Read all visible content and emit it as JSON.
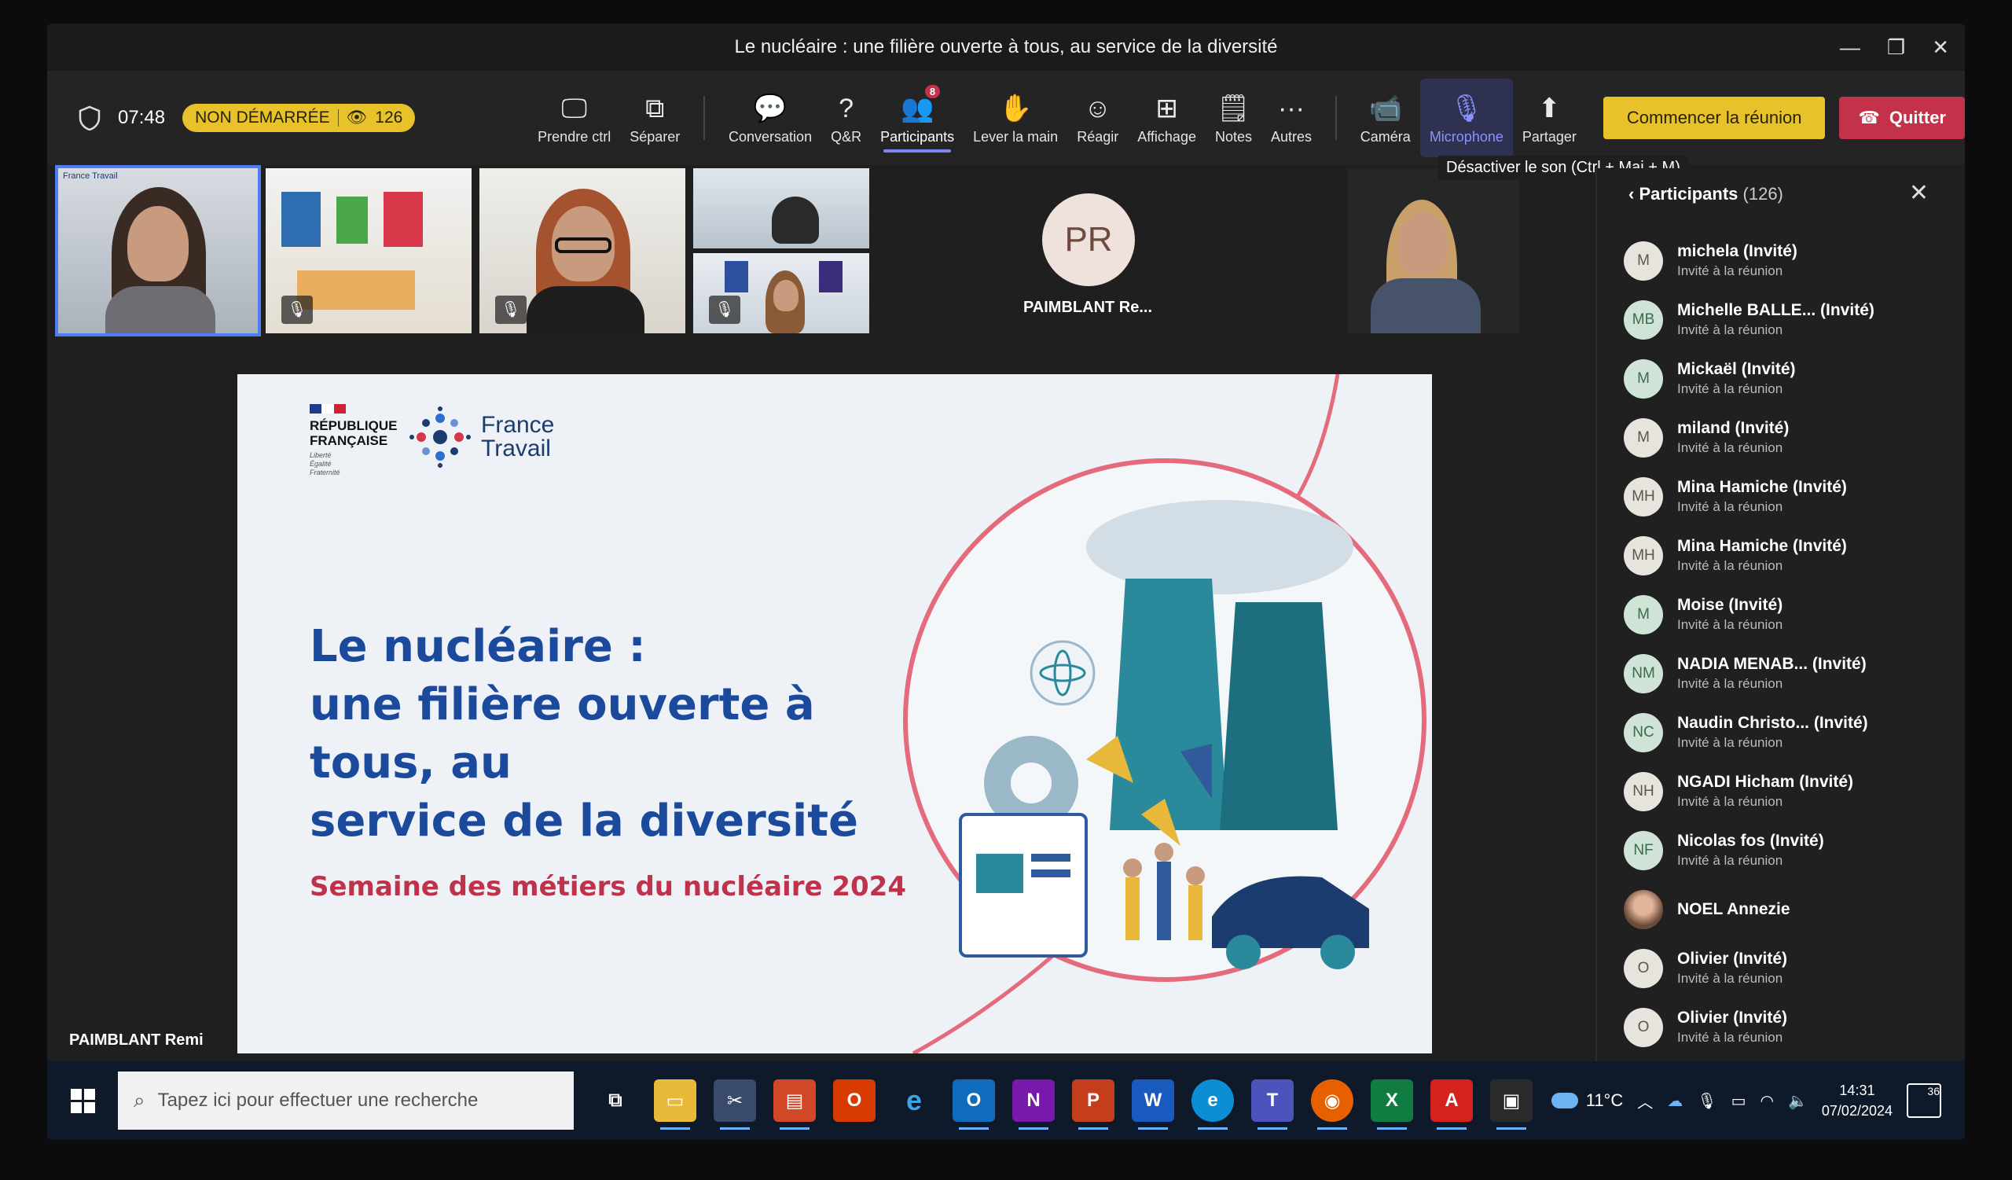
{
  "window": {
    "title": "Le nucléaire : une filière ouverte à tous, au service de la diversité"
  },
  "toolbar": {
    "time": "07:48",
    "status": "NON DÉMARRÉE",
    "viewers": "126",
    "buttons": [
      {
        "label": "Prendre ctrl",
        "icon": "take-control-icon"
      },
      {
        "label": "Séparer",
        "icon": "pop-out-icon"
      },
      {
        "label": "Conversation",
        "icon": "chat-icon"
      },
      {
        "label": "Q&R",
        "icon": "qa-icon"
      },
      {
        "label": "Participants",
        "icon": "people-icon",
        "badge": "8"
      },
      {
        "label": "Lever la main",
        "icon": "raise-hand-icon"
      },
      {
        "label": "Réagir",
        "icon": "react-icon"
      },
      {
        "label": "Affichage",
        "icon": "view-icon"
      },
      {
        "label": "Notes",
        "icon": "notes-icon"
      },
      {
        "label": "Autres",
        "icon": "more-icon"
      },
      {
        "label": "Caméra",
        "icon": "camera-icon"
      },
      {
        "label": "Microphone",
        "icon": "microphone-icon"
      },
      {
        "label": "Partager",
        "icon": "share-icon"
      }
    ],
    "start_label": "Commencer la réunion",
    "quit_label": "Quitter"
  },
  "tooltip": "Désactiver le son (Ctrl + Maj + M)",
  "video": {
    "tile1_label": "France Travail",
    "pr_initials": "PR",
    "pr_name": "PAIMBLANT Re..."
  },
  "slide": {
    "republique": "RÉPUBLIQUE\nFRANÇAISE",
    "motto": "Liberté\nÉgalité\nFraternité",
    "brand": "France\nTravail",
    "title": "Le nucléaire :\nune filière ouverte à tous, au\nservice de la diversité",
    "subtitle": "Semaine des métiers du nucléaire 2024"
  },
  "presenter": "PAIMBLANT Remi",
  "panel": {
    "title": "Participants",
    "count": "(126)",
    "participants": [
      {
        "initials": "M",
        "name": "michela (Invité)",
        "role": "Invité à la réunion"
      },
      {
        "initials": "MB",
        "name": "Michelle BALLE... (Invité)",
        "role": "Invité à la réunion"
      },
      {
        "initials": "M",
        "name": "Mickaël (Invité)",
        "role": "Invité à la réunion"
      },
      {
        "initials": "M",
        "name": "miland (Invité)",
        "role": "Invité à la réunion"
      },
      {
        "initials": "MH",
        "name": "Mina Hamiche (Invité)",
        "role": "Invité à la réunion"
      },
      {
        "initials": "MH",
        "name": "Mina Hamiche (Invité)",
        "role": "Invité à la réunion"
      },
      {
        "initials": "M",
        "name": "Moise (Invité)",
        "role": "Invité à la réunion"
      },
      {
        "initials": "NM",
        "name": "NADIA MENAB... (Invité)",
        "role": "Invité à la réunion"
      },
      {
        "initials": "NC",
        "name": "Naudin Christo... (Invité)",
        "role": "Invité à la réunion"
      },
      {
        "initials": "NH",
        "name": "NGADI Hicham (Invité)",
        "role": "Invité à la réunion"
      },
      {
        "initials": "NF",
        "name": "Nicolas fos (Invité)",
        "role": "Invité à la réunion"
      },
      {
        "initials": "",
        "name": "NOEL Annezie",
        "role": ""
      },
      {
        "initials": "O",
        "name": "Olivier (Invité)",
        "role": "Invité à la réunion"
      },
      {
        "initials": "O",
        "name": "Olivier (Invité)",
        "role": "Invité à la réunion"
      }
    ]
  },
  "taskbar": {
    "search_placeholder": "Tapez ici pour effectuer une recherche",
    "temperature": "11°C",
    "time": "14:31",
    "date": "07/02/2024",
    "notifications": "36"
  }
}
